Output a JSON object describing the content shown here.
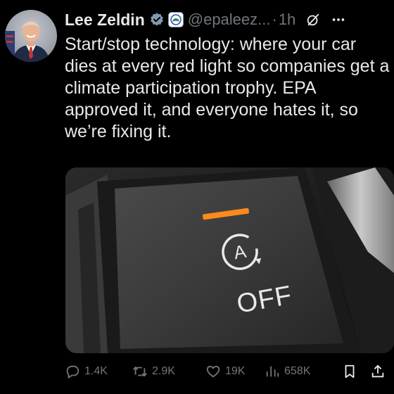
{
  "author": {
    "name": "Lee Zeldin",
    "handle": "@epaleez...",
    "separator": "·",
    "time": "1h"
  },
  "tweet": {
    "text": "Start/stop technology: where your car dies at every red light so companies get a climate participation trophy. EPA approved it, and everyone hates it, so we’re fixing it."
  },
  "media": {
    "button_label": "OFF",
    "button_symbol": "A",
    "indicator_color": "#ff8a1c"
  },
  "actions": {
    "replies": "1.4K",
    "reposts": "2.9K",
    "likes": "19K",
    "views": "658K"
  },
  "icons": {
    "verified": "verified-badge-icon",
    "org": "epa-logo-icon",
    "grok": "grok-icon",
    "more": "more-icon",
    "reply": "reply-icon",
    "repost": "repost-icon",
    "like": "heart-icon",
    "views": "views-icon",
    "bookmark": "bookmark-icon",
    "share": "share-icon"
  },
  "colors": {
    "background": "#000000",
    "text": "#e7e9ea",
    "muted": "#71767b",
    "verified_gray": "#829aab"
  }
}
